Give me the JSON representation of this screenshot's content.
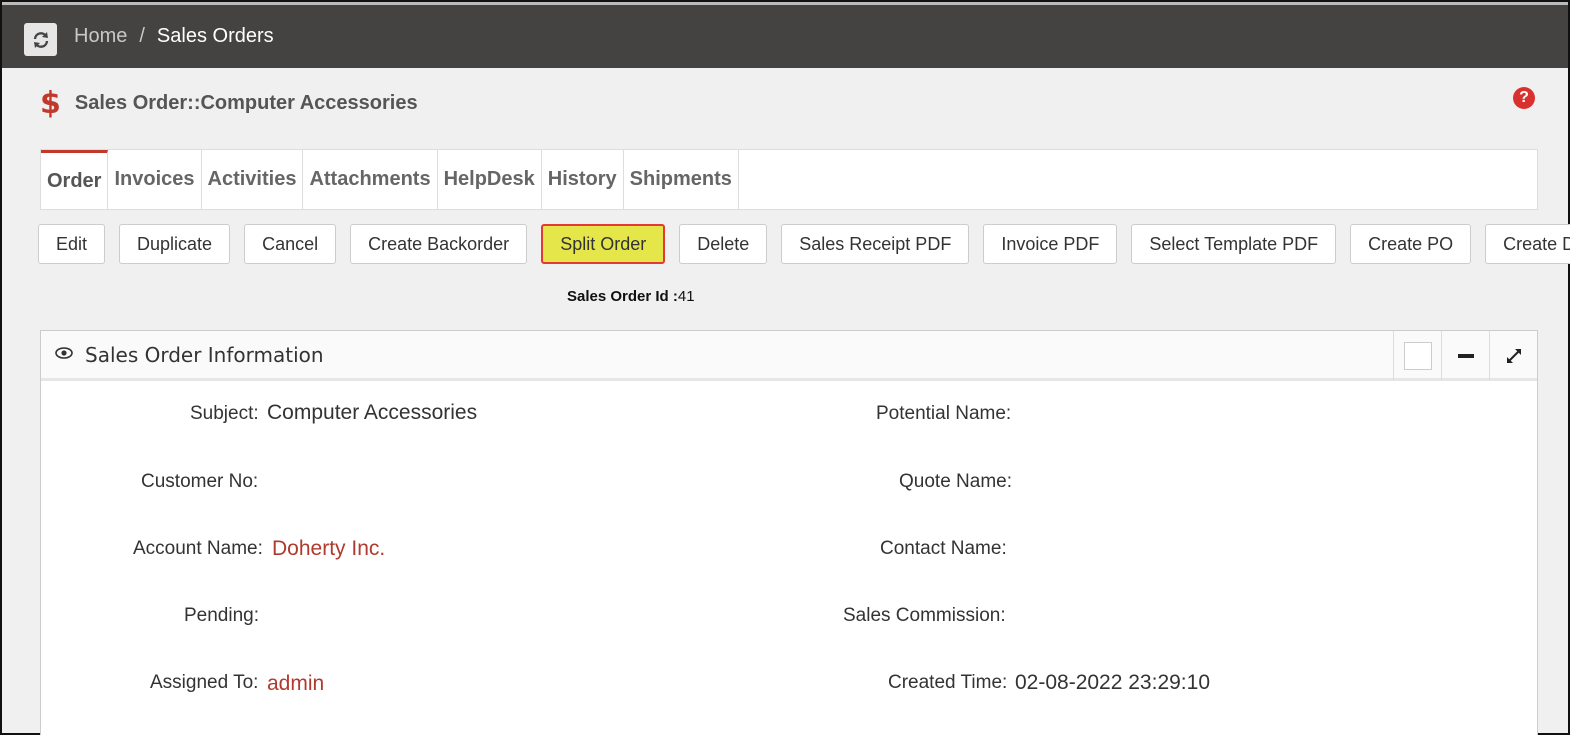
{
  "breadcrumb": {
    "home": "Home",
    "separator": "/",
    "current": "Sales Orders"
  },
  "header": {
    "icon": "dollar-icon",
    "title": "Sales Order::Computer Accessories"
  },
  "tabs": [
    {
      "label": "Order",
      "active": true
    },
    {
      "label": "Invoices"
    },
    {
      "label": "Activities"
    },
    {
      "label": "Attachments"
    },
    {
      "label": "HelpDesk"
    },
    {
      "label": "History"
    },
    {
      "label": "Shipments"
    }
  ],
  "actions": [
    "Edit",
    "Duplicate",
    "Cancel",
    "Create Backorder",
    "Split Order",
    "Delete",
    "Sales Receipt PDF",
    "Invoice PDF",
    "Select Template PDF",
    "Create PO",
    "Create Drop-"
  ],
  "sales_order_id": {
    "label": "Sales Order Id :",
    "value": "41"
  },
  "panel": {
    "title": "Sales Order Information"
  },
  "fields": {
    "subject": {
      "label": "Subject:",
      "value": "Computer Accessories"
    },
    "potential_name": {
      "label": "Potential Name:",
      "value": ""
    },
    "customer_no": {
      "label": "Customer No:",
      "value": ""
    },
    "quote_name": {
      "label": "Quote Name:",
      "value": ""
    },
    "account_name": {
      "label": "Account Name:",
      "value": "Doherty Inc."
    },
    "contact_name": {
      "label": "Contact Name:",
      "value": ""
    },
    "pending": {
      "label": "Pending:",
      "value": ""
    },
    "sales_commission": {
      "label": "Sales Commission:",
      "value": ""
    },
    "assigned_to": {
      "label": "Assigned To:",
      "value": "admin"
    },
    "created_time": {
      "label": "Created Time:",
      "value": "02-08-2022 23:29:10"
    }
  },
  "colors": {
    "topbar": "#444342",
    "accent": "#c0392b",
    "highlight": "#e4e64a"
  }
}
